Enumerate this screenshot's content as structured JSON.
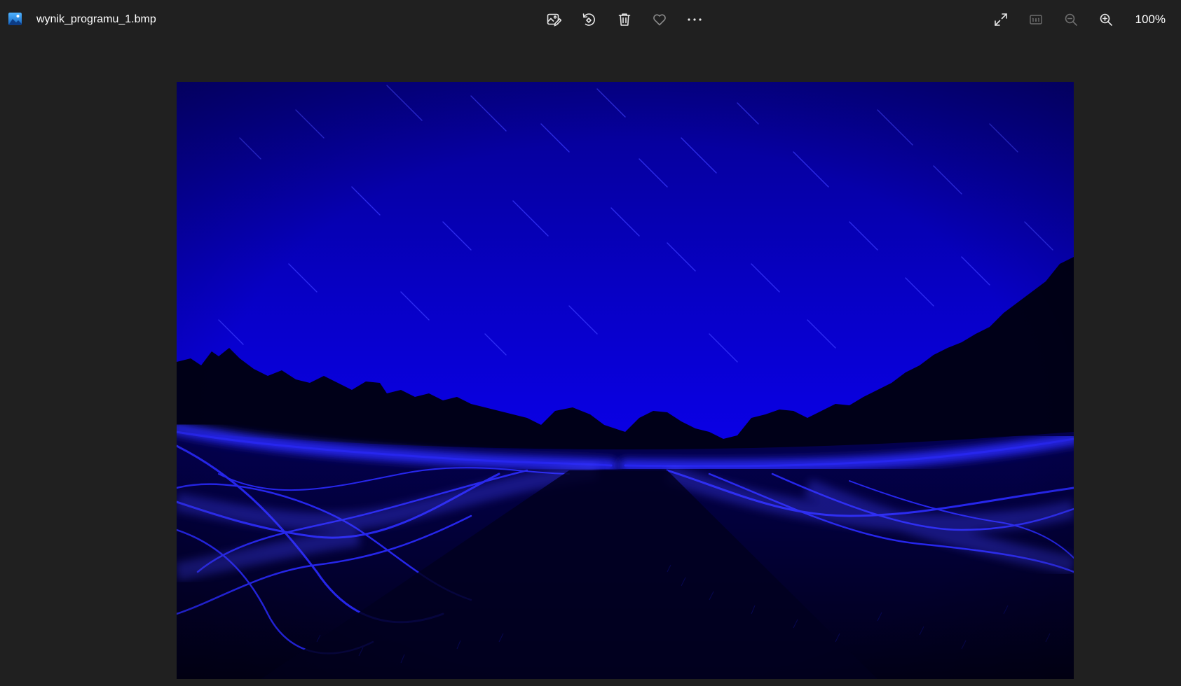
{
  "window": {
    "filename": "wynik_programu_1.bmp",
    "app_icon": "photos-app-icon"
  },
  "toolbar": {
    "actions": [
      {
        "name": "edit-image-icon"
      },
      {
        "name": "rotate-icon"
      },
      {
        "name": "delete-icon"
      },
      {
        "name": "favorite-icon"
      },
      {
        "name": "more-options-icon"
      }
    ],
    "view_actions": [
      {
        "name": "fullscreen-icon"
      },
      {
        "name": "actual-size-icon"
      },
      {
        "name": "zoom-out-icon"
      },
      {
        "name": "zoom-in-icon"
      }
    ],
    "zoom_level": "100%"
  },
  "image": {
    "description_colors": {
      "sky": "#0a00e8",
      "sky_top": "#05008f",
      "ground": "#02003a",
      "glow": "#2b2bff"
    }
  },
  "theme": {
    "background": "#202020",
    "text": "#ffffff",
    "icon": "#e6e6e6",
    "icon_disabled": "#6e6e6e"
  }
}
